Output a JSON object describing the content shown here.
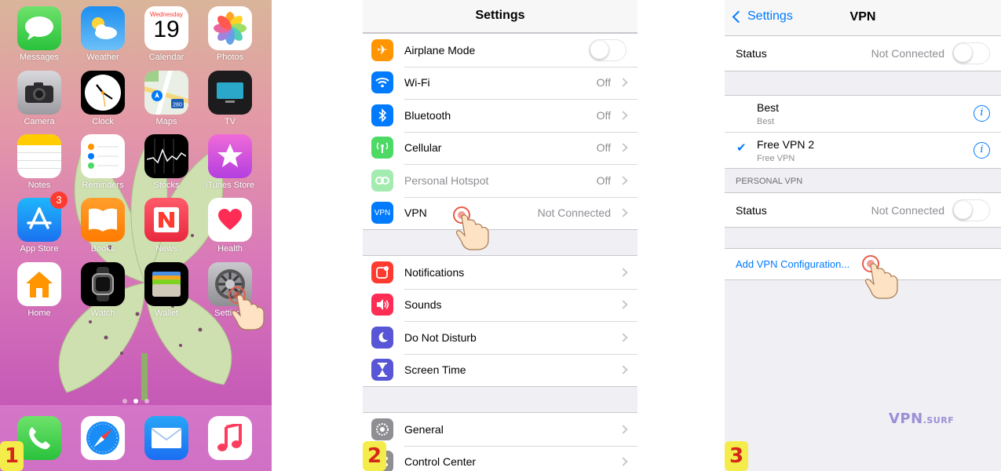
{
  "home": {
    "apps": [
      {
        "name": "Messages",
        "icon": "messages-icon"
      },
      {
        "name": "Weather",
        "icon": "weather-icon"
      },
      {
        "name": "Calendar",
        "icon": "calendar-icon"
      },
      {
        "name": "Photos",
        "icon": "photos-icon"
      },
      {
        "name": "Camera",
        "icon": "camera-icon"
      },
      {
        "name": "Clock",
        "icon": "clock-icon"
      },
      {
        "name": "Maps",
        "icon": "maps-icon"
      },
      {
        "name": "TV",
        "icon": "tv-icon"
      },
      {
        "name": "Notes",
        "icon": "notes-icon"
      },
      {
        "name": "Reminders",
        "icon": "reminders-icon"
      },
      {
        "name": "Stocks",
        "icon": "stocks-icon"
      },
      {
        "name": "iTunes Store",
        "icon": "itunes-store-icon"
      },
      {
        "name": "App Store",
        "icon": "app-store-icon"
      },
      {
        "name": "Books",
        "icon": "books-icon"
      },
      {
        "name": "News",
        "icon": "news-icon"
      },
      {
        "name": "Health",
        "icon": "health-icon"
      },
      {
        "name": "Home",
        "icon": "home-icon"
      },
      {
        "name": "Watch",
        "icon": "watch-icon"
      },
      {
        "name": "Wallet",
        "icon": "wallet-icon"
      },
      {
        "name": "Settings",
        "icon": "settings-icon"
      }
    ],
    "calendar_weekday": "Wednesday",
    "calendar_day": "19",
    "maps_shield": "280",
    "app_store_badge": "3",
    "dock": [
      "phone-icon",
      "safari-icon",
      "mail-icon",
      "music-icon"
    ],
    "step": "1"
  },
  "settings": {
    "title": "Settings",
    "group1": [
      {
        "label": "Airplane Mode",
        "value": "",
        "control": "toggle",
        "icon": "airplane-icon",
        "color": "#ff9500"
      },
      {
        "label": "Wi-Fi",
        "value": "Off",
        "control": "chevron",
        "icon": "wifi-icon",
        "color": "#007aff"
      },
      {
        "label": "Bluetooth",
        "value": "Off",
        "control": "chevron",
        "icon": "bluetooth-icon",
        "color": "#007aff"
      },
      {
        "label": "Cellular",
        "value": "Off",
        "control": "chevron",
        "icon": "cellular-icon",
        "color": "#4cd964"
      },
      {
        "label": "Personal Hotspot",
        "value": "Off",
        "control": "chevron",
        "icon": "hotspot-icon",
        "color": "#4cd964",
        "dimmed": true
      },
      {
        "label": "VPN",
        "value": "Not Connected",
        "control": "chevron",
        "icon": "vpn-icon",
        "icon_text": "VPN",
        "color": "#007aff"
      }
    ],
    "group2": [
      {
        "label": "Notifications",
        "icon": "notifications-icon",
        "color": "#ff3b30"
      },
      {
        "label": "Sounds",
        "icon": "sounds-icon",
        "color": "#ff2d55"
      },
      {
        "label": "Do Not Disturb",
        "icon": "moon-icon",
        "color": "#5856d6"
      },
      {
        "label": "Screen Time",
        "icon": "hourglass-icon",
        "color": "#5856d6"
      }
    ],
    "group3": [
      {
        "label": "General",
        "icon": "gear-icon",
        "color": "#8e8e93"
      },
      {
        "label": "Control Center",
        "icon": "control-center-icon",
        "color": "#8e8e93"
      }
    ],
    "step": "2"
  },
  "vpn": {
    "back_label": "Settings",
    "title": "VPN",
    "status_label": "Status",
    "status_value": "Not Connected",
    "configs": [
      {
        "name": "Best",
        "sub": "Best",
        "selected": false
      },
      {
        "name": "Free VPN 2",
        "sub": "Free VPN",
        "selected": true
      }
    ],
    "check_glyph": "✔",
    "info_glyph": "i",
    "personal_header": "PERSONAL VPN",
    "personal_status_label": "Status",
    "personal_status_value": "Not Connected",
    "add_label": "Add VPN Configuration...",
    "brand_main": "VPN",
    "brand_sub": ".SURF",
    "step": "3"
  },
  "colors": {
    "accent": "#007aff",
    "step_bg": "#f4ec4a",
    "step_fg": "#d5261c"
  }
}
